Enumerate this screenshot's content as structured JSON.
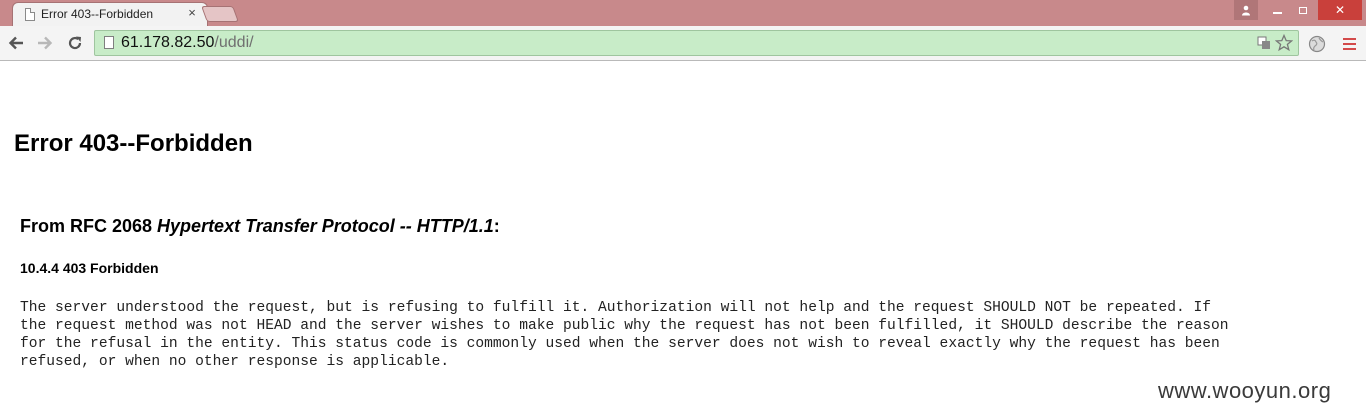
{
  "browser": {
    "tab": {
      "title": "Error 403--Forbidden",
      "close_glyph": "×"
    },
    "window_buttons": {
      "close_glyph": "✕"
    },
    "omnibox": {
      "url_host": "61.178.82.50",
      "url_path": "/uddi/"
    }
  },
  "page": {
    "heading": "Error 403--Forbidden",
    "rfc": {
      "prefix": "From RFC 2068 ",
      "italic": "Hypertext Transfer Protocol -- HTTP/1.1",
      "suffix": ":"
    },
    "section_heading": "10.4.4 403 Forbidden",
    "body_lines": [
      "The server understood the request, but is refusing to fulfill it. Authorization will not help and the request SHOULD NOT be repeated. If",
      "the request method was not HEAD and the server wishes to make public why the request has not been fulfilled, it SHOULD describe the reason",
      "for the refusal in the entity. This status code is commonly used when the server does not wish to reveal exactly why the request has been",
      "refused, or when no other response is applicable."
    ]
  },
  "watermark": "www.wooyun.org",
  "icons": {
    "back": "arrow-left-icon",
    "forward": "arrow-right-icon",
    "reload": "reload-icon",
    "page": "page-icon",
    "translate": "translate-icon",
    "bookmark": "star-icon",
    "extension": "globe-icon",
    "menu": "hamburger-menu-icon"
  },
  "colors": {
    "titlebar": "#c8898b",
    "omnibox_bg": "#c8ecc8",
    "close_button": "#c9403b",
    "menu_icon": "#d34a4a"
  }
}
